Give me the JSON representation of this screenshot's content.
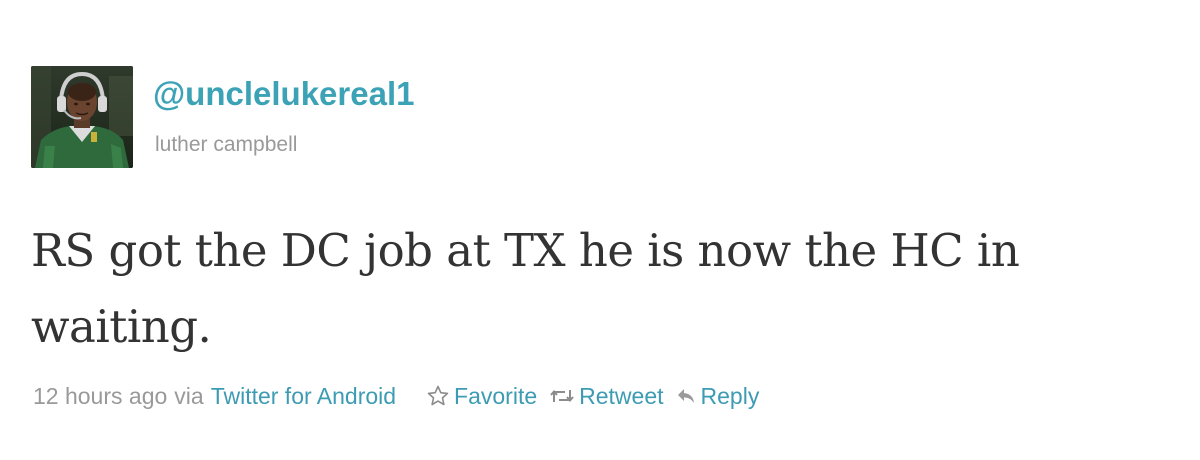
{
  "tweet": {
    "screen_name": "@unclelukereal1",
    "full_name": "luther campbell",
    "text": "RS got the DC job at TX he is now the HC in waiting.",
    "timestamp": "12 hours ago",
    "via_label": "via",
    "source": "Twitter for Android"
  },
  "actions": {
    "favorite_label": "Favorite",
    "retweet_label": "Retweet",
    "reply_label": "Reply"
  },
  "icons": {
    "favorite": "star-outline-icon",
    "retweet": "retweet-arrows-icon",
    "reply": "reply-arrow-icon"
  },
  "colors": {
    "link": "#3d9bb3",
    "screen_name": "#3ca2b6",
    "meta_gray": "#999999",
    "text": "#333333"
  }
}
